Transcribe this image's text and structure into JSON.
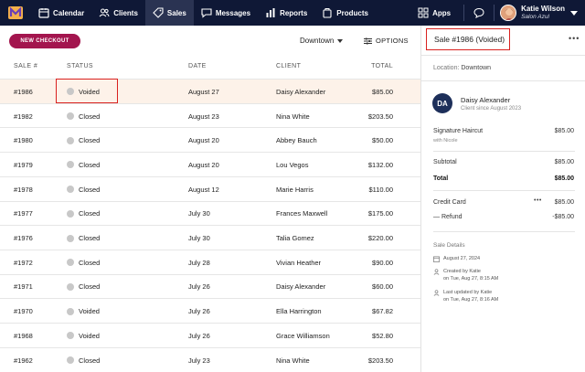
{
  "nav": {
    "items": [
      {
        "label": "Calendar",
        "icon": "calendar-icon"
      },
      {
        "label": "Clients",
        "icon": "users-icon"
      },
      {
        "label": "Sales",
        "icon": "tag-icon",
        "active": true
      },
      {
        "label": "Messages",
        "icon": "chat-icon"
      },
      {
        "label": "Reports",
        "icon": "bar-chart-icon"
      },
      {
        "label": "Products",
        "icon": "box-icon"
      }
    ],
    "apps_label": "Apps",
    "user_name": "Katie Wilson",
    "salon_name": "Salon Azul"
  },
  "toolbar": {
    "new_checkout": "NEW CHECKOUT",
    "location": "Downtown",
    "options": "OPTIONS"
  },
  "table": {
    "headers": {
      "sale": "SALE #",
      "status": "STATUS",
      "date": "DATE",
      "client": "CLIENT",
      "total": "TOTAL"
    },
    "rows": [
      {
        "sale": "#1986",
        "status": "Voided",
        "date": "August 27",
        "client": "Daisy Alexander",
        "total": "$85.00",
        "selected": true
      },
      {
        "sale": "#1982",
        "status": "Closed",
        "date": "August 23",
        "client": "Nina White",
        "total": "$203.50"
      },
      {
        "sale": "#1980",
        "status": "Closed",
        "date": "August 20",
        "client": "Abbey Bauch",
        "total": "$50.00"
      },
      {
        "sale": "#1979",
        "status": "Closed",
        "date": "August 20",
        "client": "Lou Vegos",
        "total": "$132.00"
      },
      {
        "sale": "#1978",
        "status": "Closed",
        "date": "August 12",
        "client": "Marie Harris",
        "total": "$110.00"
      },
      {
        "sale": "#1977",
        "status": "Closed",
        "date": "July 30",
        "client": "Frances Maxwell",
        "total": "$175.00"
      },
      {
        "sale": "#1976",
        "status": "Closed",
        "date": "July 30",
        "client": "Talia Gomez",
        "total": "$220.00"
      },
      {
        "sale": "#1972",
        "status": "Closed",
        "date": "July 28",
        "client": "Vivian Heather",
        "total": "$90.00"
      },
      {
        "sale": "#1971",
        "status": "Closed",
        "date": "July 26",
        "client": "Daisy Alexander",
        "total": "$60.00"
      },
      {
        "sale": "#1970",
        "status": "Voided",
        "date": "July 26",
        "client": "Ella Harrington",
        "total": "$67.82"
      },
      {
        "sale": "#1968",
        "status": "Voided",
        "date": "July 26",
        "client": "Grace Williamson",
        "total": "$52.80"
      },
      {
        "sale": "#1962",
        "status": "Closed",
        "date": "July 23",
        "client": "Nina White",
        "total": "$203.50"
      }
    ]
  },
  "panel": {
    "title": "Sale #1986 (Voided)",
    "location_label": "Location:",
    "location_value": "Downtown",
    "client_initials": "DA",
    "client_name": "Daisy Alexander",
    "client_since": "Client since August 2023",
    "service_name": "Signature Haircut",
    "service_with": "with Nicole",
    "service_price": "$85.00",
    "subtotal_label": "Subtotal",
    "subtotal_value": "$85.00",
    "total_label": "Total",
    "total_value": "$85.00",
    "payment_label": "Credit Card",
    "payment_value": "$85.00",
    "refund_label": "— Refund",
    "refund_value": "-$85.00",
    "details_title": "Sale Details",
    "detail_date": "August 27, 2024",
    "created_by": "Created by Katie",
    "created_on": "on Tue, Aug 27, 8:15 AM",
    "updated_by": "Last updated by Katie",
    "updated_on": "on Tue, Aug 27, 8:16 AM"
  },
  "colors": {
    "nav_bg": "#0f1836",
    "accent": "#a3154e",
    "highlight": "#d9211f",
    "selected_row": "#fdf2e9"
  }
}
